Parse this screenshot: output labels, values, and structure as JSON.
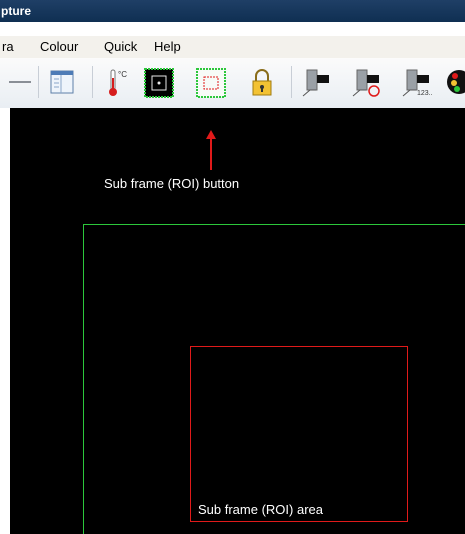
{
  "window": {
    "title": "pture"
  },
  "menu": {
    "items": [
      "ra",
      "Colour",
      "Quick",
      "Help"
    ]
  },
  "toolbar": {
    "buttons": [
      {
        "name": "minimize-bar-icon"
      },
      {
        "name": "window-layout-icon"
      },
      {
        "name": "thermometer-icon",
        "label": "°C"
      },
      {
        "name": "full-frame-icon"
      },
      {
        "name": "sub-frame-roi-icon"
      },
      {
        "name": "lock-icon"
      },
      {
        "name": "camera-capture-icon"
      },
      {
        "name": "camera-refresh-icon"
      },
      {
        "name": "camera-sequence-icon",
        "label": "123.."
      },
      {
        "name": "traffic-light-icon"
      }
    ]
  },
  "annotations": {
    "roi_button": "Sub frame (ROI) button",
    "roi_area": "Sub frame (ROI) area"
  },
  "colors": {
    "canvas": "#000000",
    "full_frame": "#2cc73b",
    "roi_frame": "#e01a1a",
    "arrow": "#e01a1a"
  }
}
